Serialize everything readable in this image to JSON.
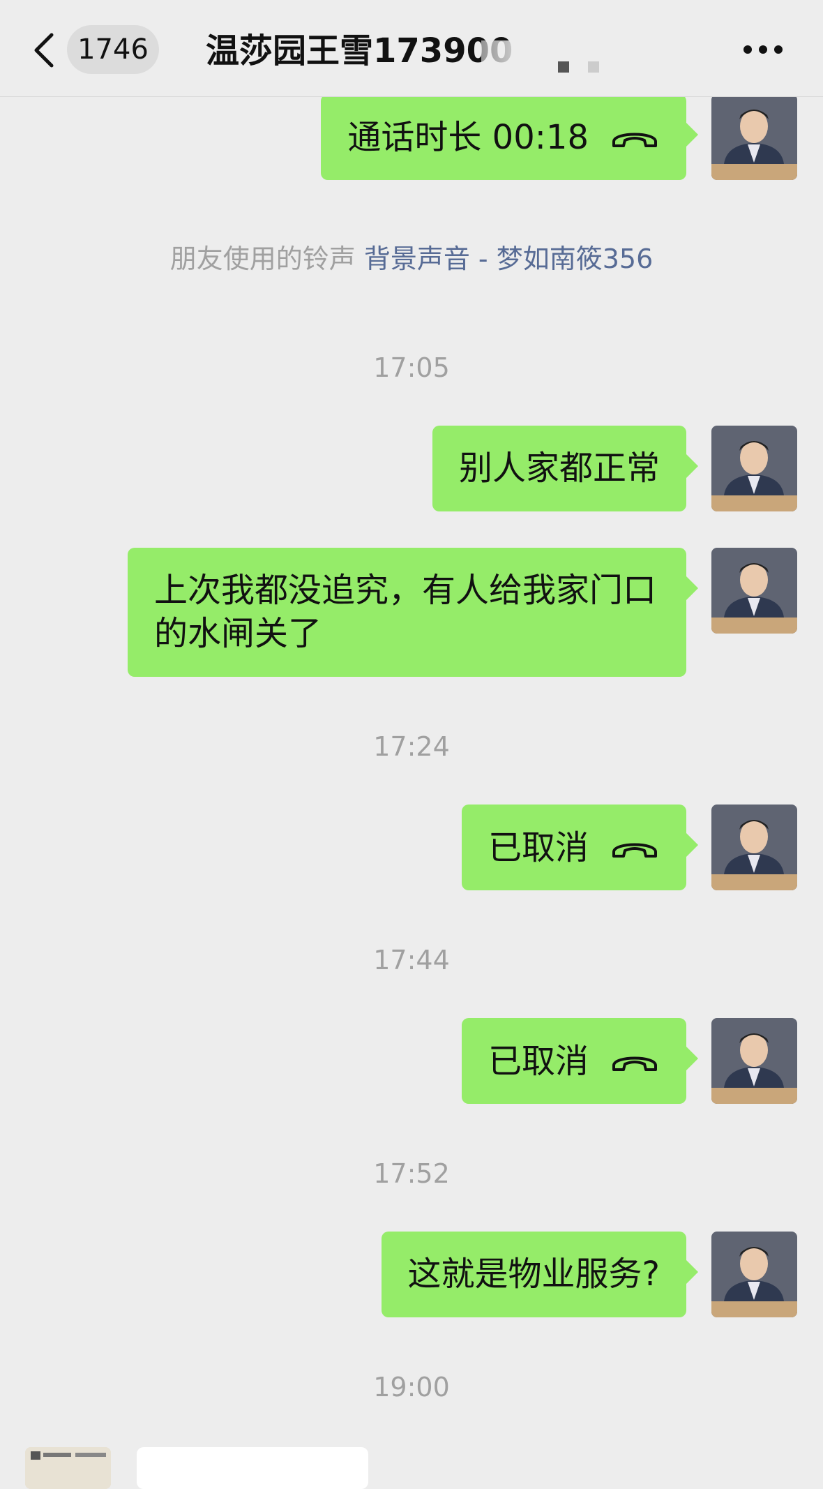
{
  "header": {
    "back_label": "back",
    "unread_count": "1746",
    "title": "温莎园王雪173900"
  },
  "messages": [
    {
      "kind": "call",
      "text": "通话时长 00:18"
    },
    {
      "kind": "system",
      "text": "朋友使用的铃声",
      "link": "背景声音 - 梦如南筱356"
    },
    {
      "kind": "time",
      "text": "17:05"
    },
    {
      "kind": "text",
      "text": "别人家都正常"
    },
    {
      "kind": "text",
      "text": "上次我都没追究，有人给我家门口的水闸关了"
    },
    {
      "kind": "time",
      "text": "17:24"
    },
    {
      "kind": "call",
      "text": "已取消"
    },
    {
      "kind": "time",
      "text": "17:44"
    },
    {
      "kind": "call",
      "text": "已取消"
    },
    {
      "kind": "time",
      "text": "17:52"
    },
    {
      "kind": "text",
      "text": "这就是物业服务?"
    },
    {
      "kind": "time",
      "text": "19:00"
    }
  ],
  "colors": {
    "background": "#ededed",
    "bubble_self": "#95ec69",
    "link": "#576b95",
    "time": "#a0a0a0"
  },
  "icons": {
    "back": "chevron-left-icon",
    "more": "more-dots-icon",
    "call": "phone-hangup-icon"
  }
}
